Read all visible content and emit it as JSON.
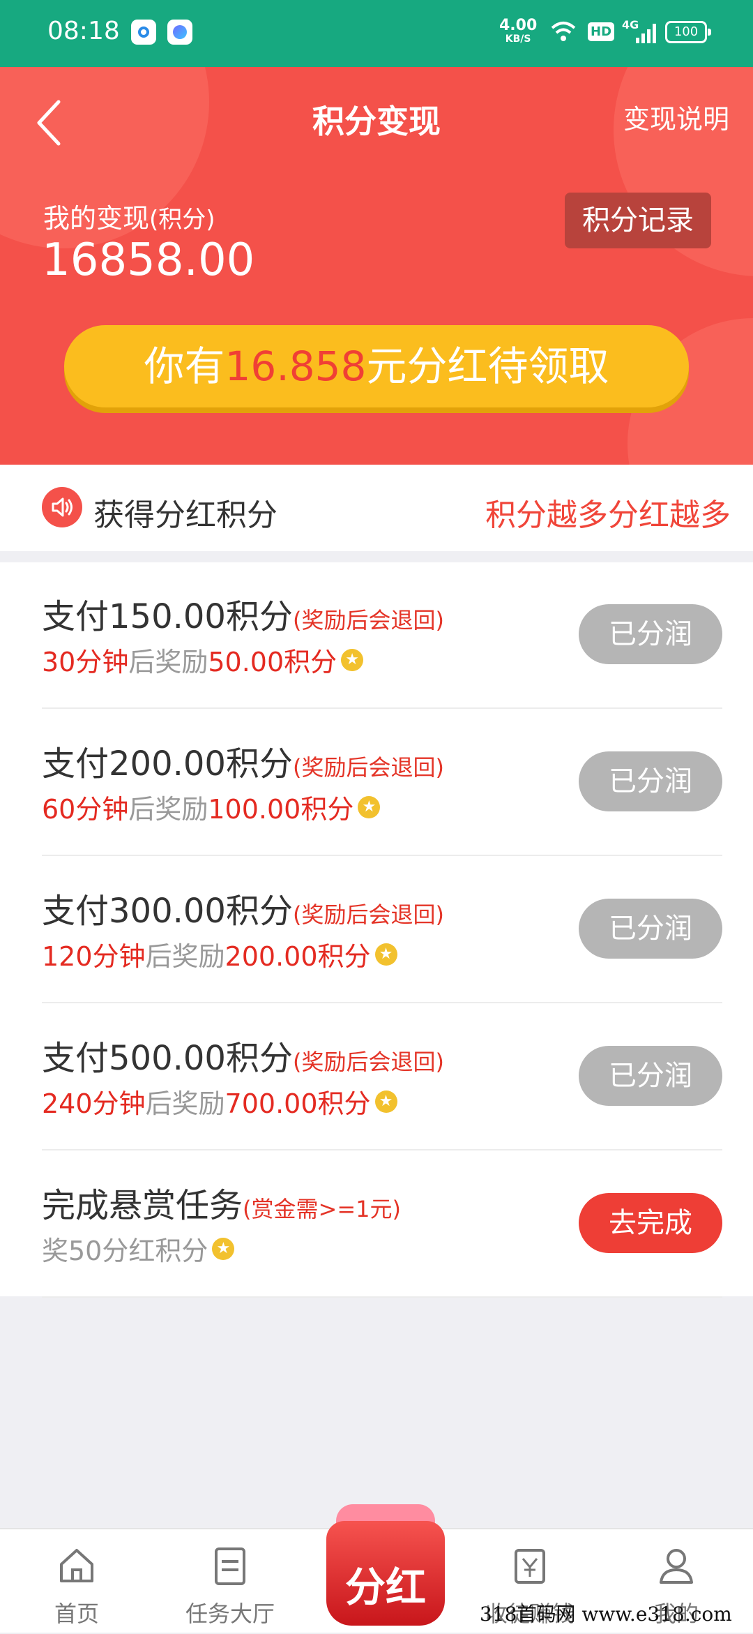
{
  "status_bar": {
    "time": "08:18",
    "net_speed": "4.00",
    "net_unit": "KB/S",
    "hd": "HD",
    "signal": "4G",
    "battery": "100"
  },
  "header": {
    "title": "积分变现",
    "right_link": "变现说明"
  },
  "summary": {
    "label": "我的变现",
    "unit": "(积分)",
    "value": "16858.00",
    "record_button": "积分记录"
  },
  "bonus": {
    "prefix": "你有",
    "amount": "16.858",
    "suffix": "元分红待领取"
  },
  "notice": {
    "label": "获得分红积分",
    "right": "积分越多分红越多"
  },
  "tasks": [
    {
      "title": "支付150.00积分",
      "note": "(奖励后会退回)",
      "time": "30分钟",
      "mid": "后奖励",
      "reward": "50.00积分",
      "button": "已分润",
      "state": "done"
    },
    {
      "title": "支付200.00积分",
      "note": "(奖励后会退回)",
      "time": "60分钟",
      "mid": "后奖励",
      "reward": "100.00积分",
      "button": "已分润",
      "state": "done"
    },
    {
      "title": "支付300.00积分",
      "note": "(奖励后会退回)",
      "time": "120分钟",
      "mid": "后奖励",
      "reward": "200.00积分",
      "button": "已分润",
      "state": "done"
    },
    {
      "title": "支付500.00积分",
      "note": "(奖励后会退回)",
      "time": "240分钟",
      "mid": "后奖励",
      "reward": "700.00积分",
      "button": "已分润",
      "state": "done"
    },
    {
      "title": "完成悬赏任务",
      "note": "(赏金需>=1元)",
      "time": "",
      "mid": "奖50分红积分",
      "reward": "",
      "button": "去完成",
      "state": "go"
    }
  ],
  "tabbar": {
    "home": "首页",
    "tasks": "任务大厅",
    "center": "分红",
    "recruit": "收徒赚钱",
    "mine": "我的"
  },
  "watermark": "318首码网 www.e318.com",
  "colors": {
    "status_bar": "#17a980",
    "hero": "#f4514a",
    "bonus_button": "#fbbd1e",
    "accent_red": "#e42a21",
    "done_button": "#b5b5b5",
    "go_button": "#ee3e36"
  }
}
